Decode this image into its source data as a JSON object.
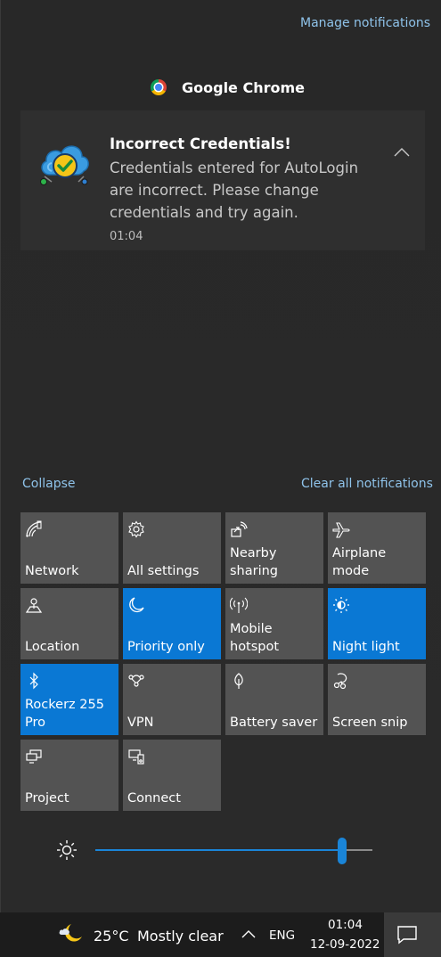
{
  "header": {
    "manage_label": "Manage notifications"
  },
  "app_group": {
    "name": "Google Chrome",
    "icon": "chrome-icon"
  },
  "notification": {
    "icon": "cloud-check-icon",
    "title": "Incorrect Credentials!",
    "body": "Credentials entered for AutoLogin are incorrect. Please change credentials and try again.",
    "time": "01:04"
  },
  "actions": {
    "collapse_label": "Collapse",
    "clear_all_label": "Clear all notifications"
  },
  "quick_actions": [
    {
      "label": "Network",
      "icon": "network-icon",
      "active": false
    },
    {
      "label": "All settings",
      "icon": "gear-icon",
      "active": false
    },
    {
      "label": "Nearby sharing",
      "icon": "nearby-sharing-icon",
      "active": false
    },
    {
      "label": "Airplane mode",
      "icon": "airplane-icon",
      "active": false
    },
    {
      "label": "Location",
      "icon": "location-icon",
      "active": false
    },
    {
      "label": "Priority only",
      "icon": "moon-icon",
      "active": true
    },
    {
      "label": "Mobile hotspot",
      "icon": "hotspot-icon",
      "active": false
    },
    {
      "label": "Night light",
      "icon": "night-light-icon",
      "active": true
    },
    {
      "label": "Rockerz 255 Pro",
      "icon": "bluetooth-icon",
      "active": true
    },
    {
      "label": "VPN",
      "icon": "vpn-icon",
      "active": false
    },
    {
      "label": "Battery saver",
      "icon": "battery-saver-icon",
      "active": false
    },
    {
      "label": "Screen snip",
      "icon": "screen-snip-icon",
      "active": false
    },
    {
      "label": "Project",
      "icon": "project-icon",
      "active": false
    },
    {
      "label": "Connect",
      "icon": "connect-icon",
      "active": false
    }
  ],
  "brightness": {
    "icon": "brightness-icon",
    "level": 0.89
  },
  "taskbar": {
    "weather_icon": "moon-cloud-icon",
    "temperature": "25°C",
    "weather_text": "Mostly clear",
    "language": "ENG",
    "time": "01:04",
    "date": "12-09-2022",
    "notification_icon": "action-center-icon"
  },
  "colors": {
    "accent": "#0a78d4",
    "tile": "#535353",
    "link": "#8fc3ea",
    "panel": "#282828"
  }
}
